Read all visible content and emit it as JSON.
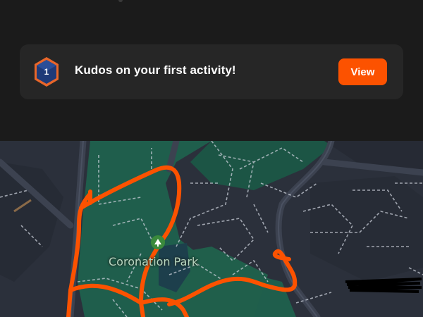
{
  "notification": {
    "badge_number": "1",
    "message": "Kudos on your first activity!",
    "action_label": "View",
    "badge_colors": {
      "fill": "#1e3a78",
      "border": "#e8662a"
    }
  },
  "map": {
    "place_label": "Coronation Park",
    "place_icon": "park-pin-icon",
    "route_color": "#fc5200",
    "park_color": "#1f5e4c",
    "road_color": "#3c4250"
  },
  "colors": {
    "accent": "#fc5200",
    "background": "#1a1a1a",
    "card": "#262626"
  }
}
